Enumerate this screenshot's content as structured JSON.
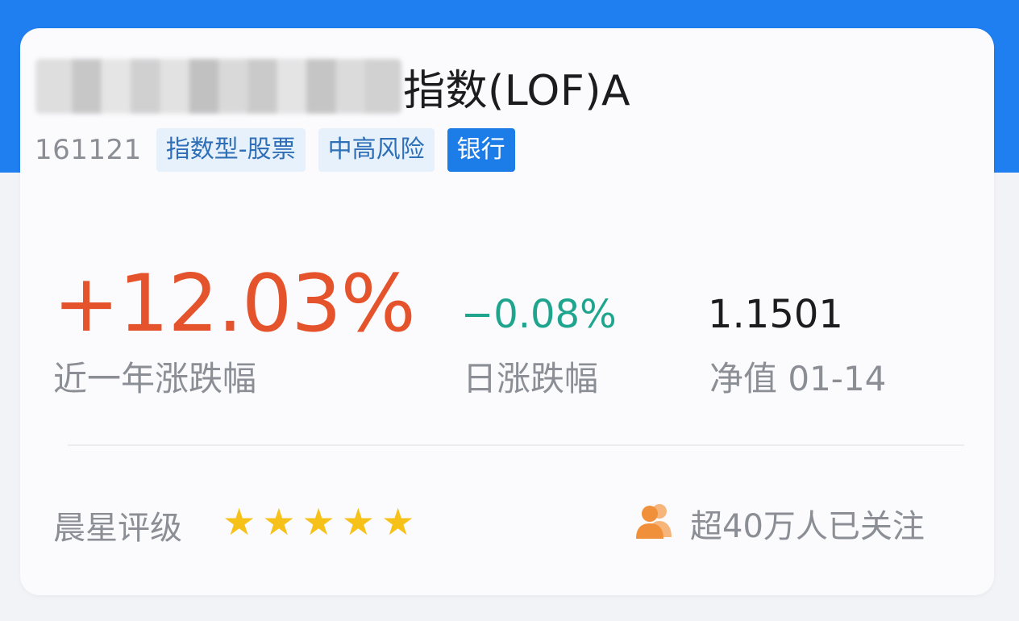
{
  "theme": {
    "banner_color": "#1f7ef0",
    "up_color": "#e5532c",
    "down_color": "#1fa58e",
    "star_color": "#f6c21a",
    "tag_solid_color": "#1c7de8",
    "follow_icon_color": "#f0903a"
  },
  "fund": {
    "title_visible": "指数(LOF)A",
    "code": "161121",
    "tags": [
      {
        "label": "指数型-股票",
        "style": "light"
      },
      {
        "label": "中高风险",
        "style": "light"
      },
      {
        "label": "银行",
        "style": "solid"
      }
    ]
  },
  "stats": {
    "year_change": "+12.03%",
    "year_change_label": "近一年涨跌幅",
    "day_change": "−0.08%",
    "day_change_label": "日涨跌幅",
    "nav": "1.1501",
    "nav_label": "净值 01-14"
  },
  "rating": {
    "label": "晨星评级",
    "stars": 5,
    "star_icon": "star-icon"
  },
  "follow": {
    "icon": "people-icon",
    "text": "超40万人已关注"
  }
}
